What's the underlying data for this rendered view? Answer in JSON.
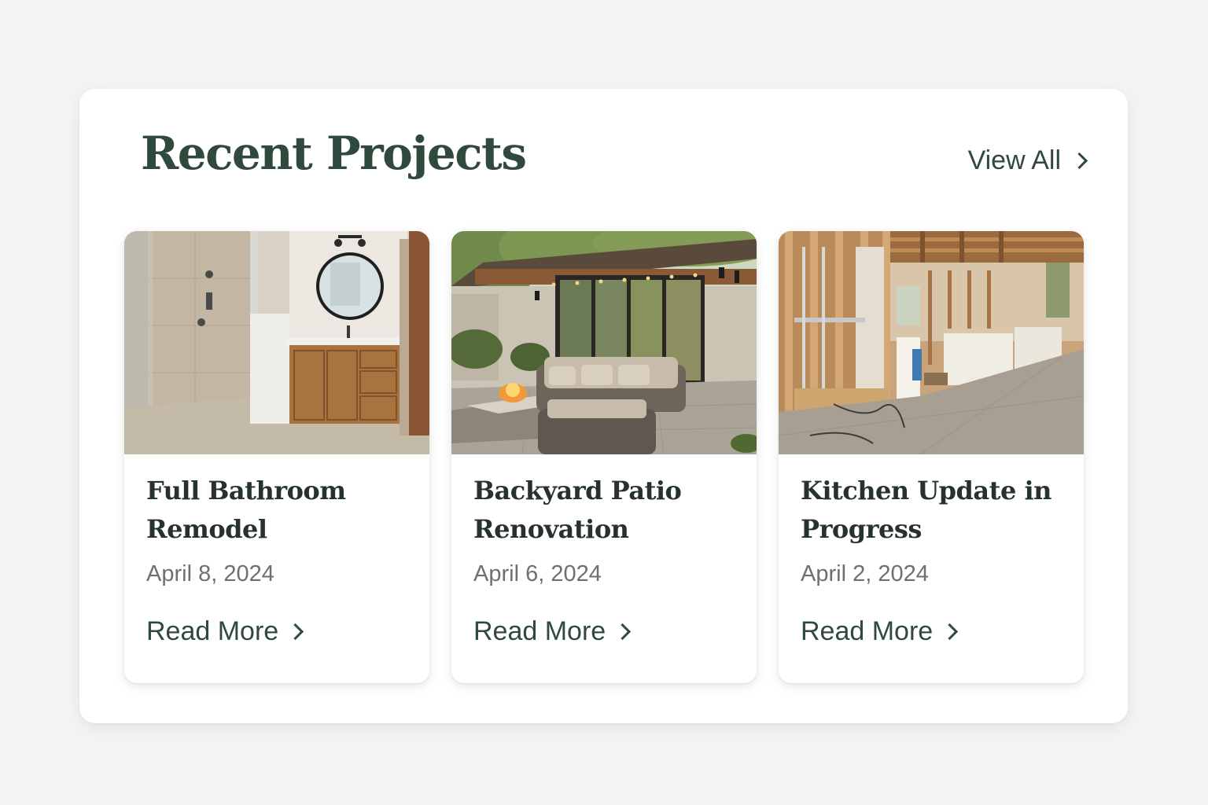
{
  "section": {
    "title": "Recent Projects",
    "view_all_label": "View All"
  },
  "projects": [
    {
      "title_line1": "Full Bathroom",
      "title_line2": "Remodel",
      "date": "April 8, 2024",
      "link_label": "Read More",
      "image": "bathroom-photo"
    },
    {
      "title_line1": "Backyard Patio",
      "title_line2": "Renovation",
      "date": "April 6, 2024",
      "link_label": "Read More",
      "image": "patio-photo"
    },
    {
      "title_line1": "Kitchen Update in",
      "title_line2": "Progress",
      "date": "April 2, 2024",
      "link_label": "Read More",
      "image": "kitchen-construction-photo"
    }
  ],
  "colors": {
    "accent": "#2f4a3d",
    "title_text": "#26322c",
    "date_text": "#6f6f6f",
    "page_background": "#f4f4f2"
  }
}
